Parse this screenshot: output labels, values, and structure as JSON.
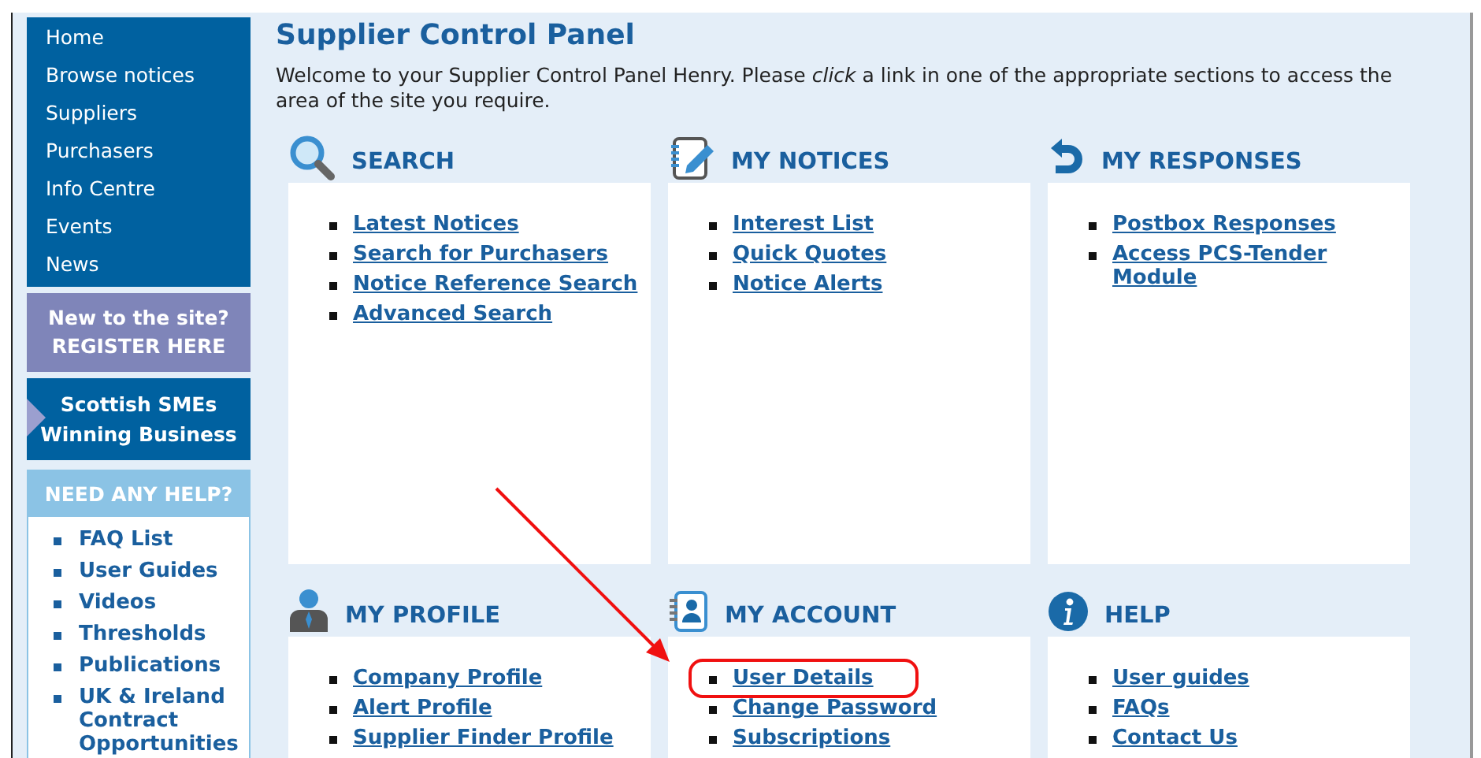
{
  "sidebar": {
    "nav": [
      {
        "label": "Home"
      },
      {
        "label": "Browse notices"
      },
      {
        "label": "Suppliers"
      },
      {
        "label": "Purchasers"
      },
      {
        "label": "Info Centre"
      },
      {
        "label": "Events"
      },
      {
        "label": "News"
      }
    ],
    "register_banner": {
      "lines": [
        "New to the site?",
        "REGISTER HERE"
      ]
    },
    "sme_banner": {
      "lines": [
        "Scottish SMEs",
        "Winning Business"
      ]
    },
    "help_box": {
      "title": "NEED ANY HELP?",
      "links": [
        "FAQ List",
        "User Guides",
        "Videos",
        "Thresholds",
        "Publications",
        "UK & Ireland Contract Opportunities"
      ]
    }
  },
  "main": {
    "title": "Supplier Control Panel",
    "intro": "Welcome to your Supplier Control Panel Henry. Please *click* a link in one of the appropriate sections to access the area of the site you require.",
    "sections": [
      {
        "kind": "search",
        "title": "SEARCH",
        "links": [
          {
            "label": "Latest Notices",
            "highlighted": false
          },
          {
            "label": "Search for Purchasers",
            "highlighted": false
          },
          {
            "label": "Notice Reference Search",
            "highlighted": false
          },
          {
            "label": "Advanced Search",
            "highlighted": false
          }
        ]
      },
      {
        "kind": "notices",
        "title": "MY NOTICES",
        "links": [
          {
            "label": "Interest List",
            "highlighted": false
          },
          {
            "label": "Quick Quotes",
            "highlighted": false
          },
          {
            "label": "Notice Alerts",
            "highlighted": false
          }
        ]
      },
      {
        "kind": "responses",
        "title": "MY RESPONSES",
        "links": [
          {
            "label": "Postbox Responses",
            "highlighted": false
          },
          {
            "label": "Access PCS-Tender Module",
            "highlighted": false
          }
        ]
      },
      {
        "kind": "profile",
        "title": "MY PROFILE",
        "links": [
          {
            "label": "Company Profile",
            "highlighted": false
          },
          {
            "label": "Alert Profile",
            "highlighted": false
          },
          {
            "label": "Supplier Finder Profile",
            "highlighted": false
          }
        ]
      },
      {
        "kind": "account",
        "title": "MY ACCOUNT",
        "links": [
          {
            "label": "User Details",
            "highlighted": true
          },
          {
            "label": "Change Password",
            "highlighted": false
          },
          {
            "label": "Subscriptions",
            "highlighted": false
          }
        ]
      },
      {
        "kind": "help",
        "title": "HELP",
        "links": [
          {
            "label": "User guides",
            "highlighted": false
          },
          {
            "label": "FAQs",
            "highlighted": false
          },
          {
            "label": "Contact Us",
            "highlighted": false
          }
        ]
      }
    ]
  }
}
